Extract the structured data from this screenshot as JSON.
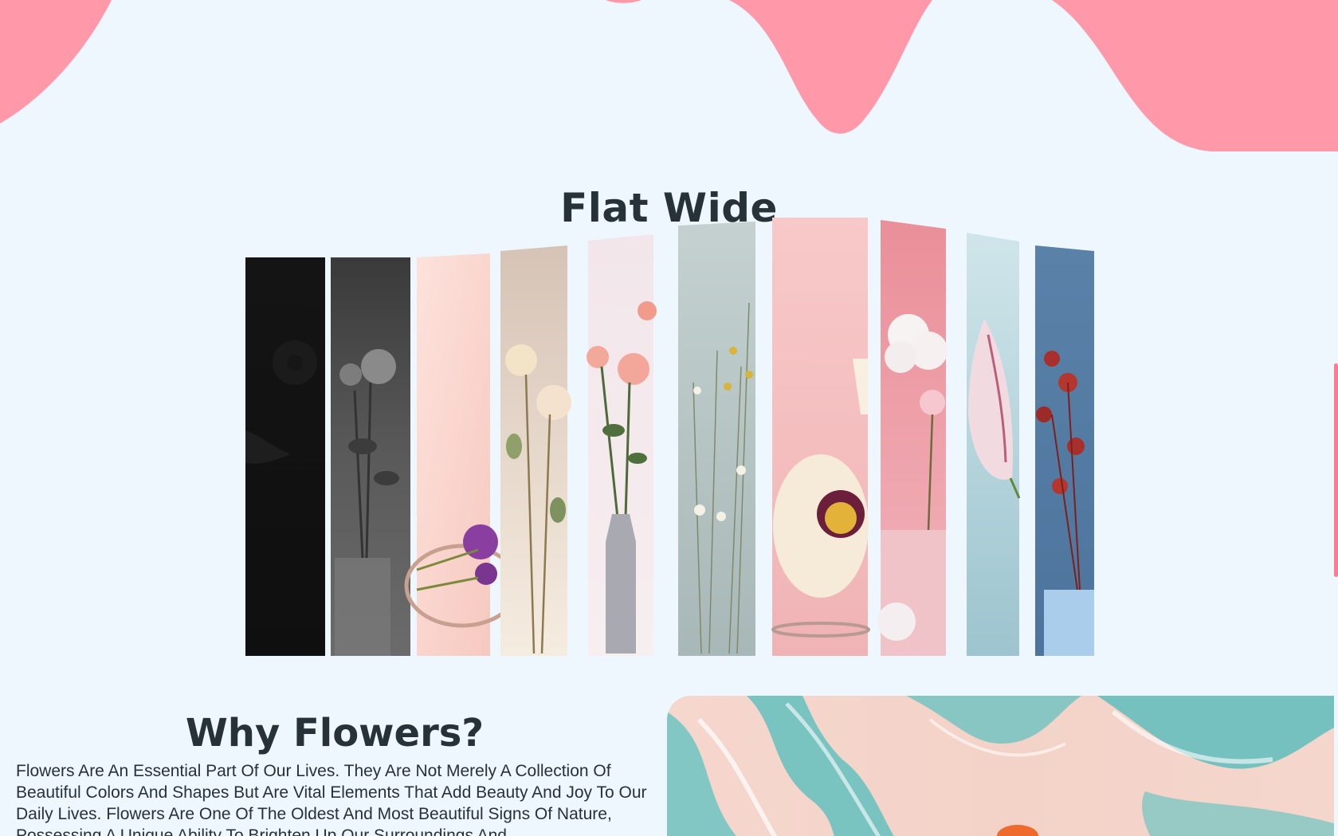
{
  "colors": {
    "background": "#eef6fe",
    "blob": "#ff98a9",
    "heading": "#263238",
    "scroll_accent": "#ff7b93"
  },
  "gallery": {
    "title": "Flat Wide",
    "panels": [
      {
        "name": "dark-gerbera"
      },
      {
        "name": "grey-roses-vase"
      },
      {
        "name": "pink-allium-ring"
      },
      {
        "name": "cream-roses"
      },
      {
        "name": "pink-roses-vase"
      },
      {
        "name": "wildflowers-grey"
      },
      {
        "name": "peony-pink"
      },
      {
        "name": "rose-cloud"
      },
      {
        "name": "pink-tulip-blue"
      },
      {
        "name": "red-dried-flowers"
      }
    ]
  },
  "why": {
    "title": "Why Flowers?",
    "text": "Flowers Are An Essential Part Of Our Lives. They Are Not Merely A Collection Of Beautiful Colors And Shapes But Are Vital Elements That Add Beauty And Joy To Our Daily Lives. Flowers Are One Of The Oldest And Most Beautiful Signs Of Nature, Possessing A Unique Ability To Brighten Up Our Surroundings And"
  },
  "hero_image": {
    "name": "marble-flower-image"
  }
}
